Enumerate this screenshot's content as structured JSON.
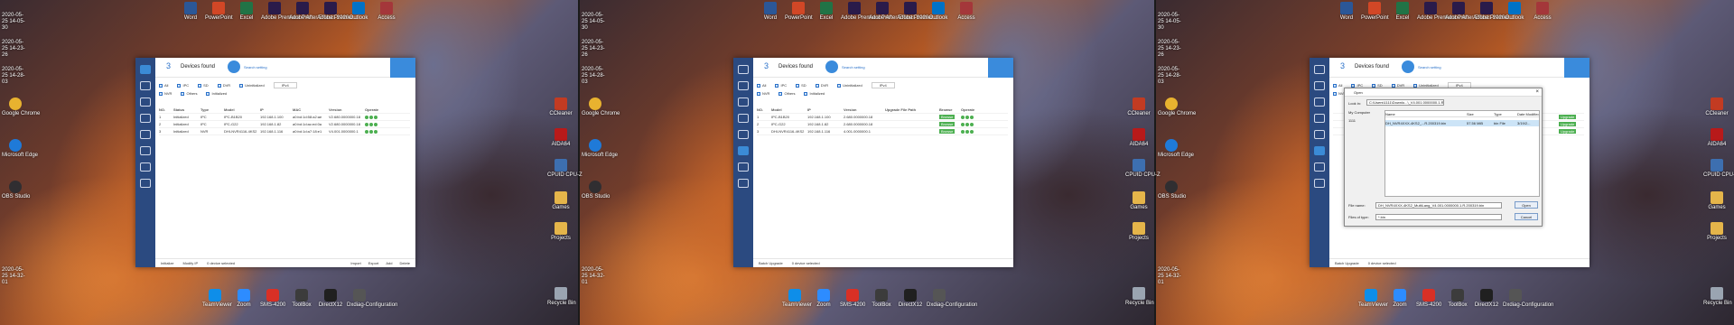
{
  "colors": {
    "accent": "#3a8bdc",
    "sidebar": "#2b4a80",
    "ok_green": "#4caf50"
  },
  "desktop": {
    "top_icons": [
      "Word",
      "PowerPoint",
      "Excel",
      "Adobe Premiere Pro",
      "Adobe After Effects 2020",
      "Adobe Premier...",
      "Outlook",
      "Access"
    ],
    "left_dates": [
      "2020-05-25\n14-05-30",
      "2020-05-25\n14-23-26",
      "2020-05-25\n14-28-03"
    ],
    "left_icons": [
      "Google Chrome",
      "Microsoft Edge",
      "OBS Studio"
    ],
    "right_icons": [
      "CCleaner",
      "AIDA64",
      "CPUID CPU-Z",
      "Games",
      "Projects",
      "Recycle Bin"
    ],
    "bottom_date": "2020-05-25\n14-32-01",
    "bottom_icons": [
      "TeamViewer",
      "Zoom",
      "SMS-4200",
      "ToolBox",
      "DirectX12",
      "Dxdiag-Configuration"
    ]
  },
  "app": {
    "count": "3",
    "devices_found": "Devices found",
    "search_setting": "Search setting",
    "filters_row1": [
      "All",
      "IPC",
      "SD",
      "DVR",
      "Uninitialized"
    ],
    "filters_row2": [
      "NVR",
      "Others",
      "Initialized"
    ],
    "ip_select": "IPv4",
    "panel1": {
      "columns": [
        "NO.",
        "Status",
        "Type",
        "Model",
        "IP",
        "MAC",
        "Version",
        "Operate"
      ],
      "rows": [
        [
          "1",
          "Initialized",
          "IPC",
          "IPC-B1B20",
          "192.168.1.100",
          "a0:bd:1d:58:a2:ae",
          "V2.680.0000000.18",
          ""
        ],
        [
          "2",
          "Initialized",
          "IPC",
          "IPC-G22",
          "192.168.1.82",
          "a0:bd:1d:ac:ed:0a",
          "V2.680.0000000.18",
          ""
        ],
        [
          "3",
          "Initialized",
          "NVR",
          "DHI-NVR4116-4KS2",
          "192.168.1.116",
          "a0:bd:1d:a7:18:e1",
          "V4.001.0000000.1",
          ""
        ]
      ],
      "footer_left": [
        "Initialize",
        "Modify IP",
        "0 device selected"
      ],
      "footer_right": [
        "Import",
        "Export",
        "Add",
        "Delete"
      ]
    },
    "panel2": {
      "columns": [
        "NO.",
        "Model",
        "IP",
        "Version",
        "Upgrade File Path",
        "Browse",
        "Operate"
      ],
      "rows": [
        [
          "1",
          "IPC-B1B20",
          "192.168.1.100",
          "2.680.0000000.18",
          "",
          "Browse",
          ""
        ],
        [
          "2",
          "IPC-G22",
          "192.168.1.82",
          "2.680.0000000.18",
          "",
          "Browse",
          ""
        ],
        [
          "3",
          "DHI-NVR4116-4KS2",
          "192.168.1.116",
          "4.001.0000000.1",
          "",
          "Browse",
          ""
        ]
      ],
      "footer_left": [
        "Batch Upgrade",
        "0 device selected"
      ]
    },
    "panel3": {
      "upgrade_buttons": [
        "Upgrade",
        "Upgrade",
        "Upgrade"
      ],
      "footer_left": [
        "Batch Upgrade",
        "0 device selected"
      ]
    }
  },
  "dialog": {
    "title": "Open",
    "look_in_label": "Look in:",
    "look_in_value": "C:\\Users\\1111\\Downlo...\\_V4.001.0000000.1.R",
    "places": [
      "My Computer",
      "1111"
    ],
    "columns": [
      "Name",
      "Size",
      "Type",
      "Date Modified"
    ],
    "file": [
      "DH_NVR4XXX-4KS2_...R.200319.bin",
      "57.56 MiB",
      "bin File",
      "3/19/2..."
    ],
    "file_name_label": "File name:",
    "file_name_value": "DH_NVR4XXX-4KS2_MultiLang_V4.001.0000000.1.R.200319.bin",
    "file_type_label": "Files of type:",
    "file_type_value": "*.bin",
    "open_label": "Open",
    "cancel_label": "Cancel"
  }
}
